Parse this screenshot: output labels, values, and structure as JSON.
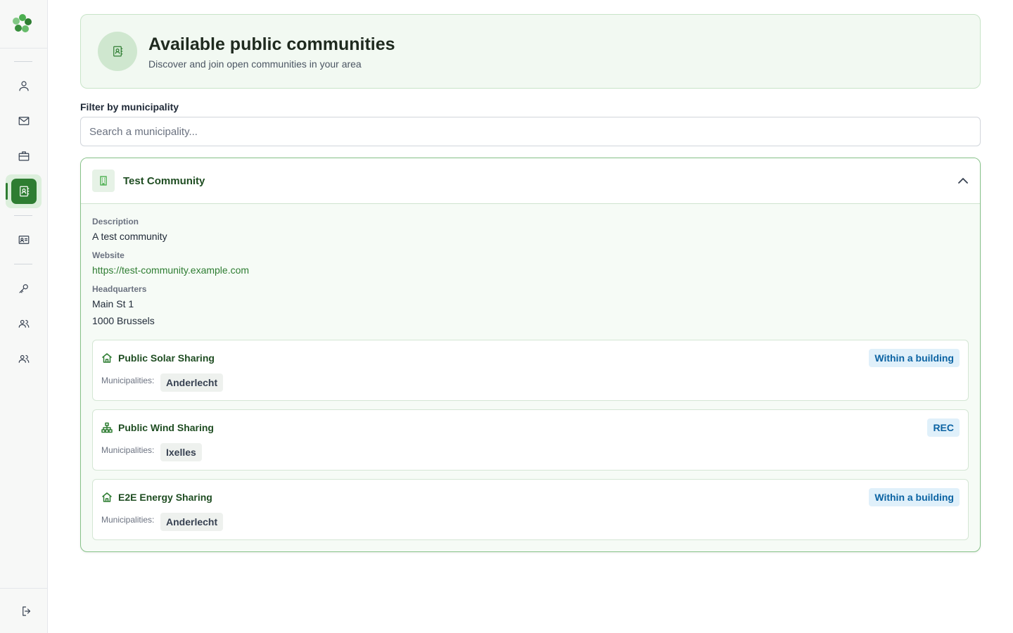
{
  "sidebar": {
    "items": [
      {
        "name": "person-icon"
      },
      {
        "name": "mail-icon"
      },
      {
        "name": "briefcase-icon"
      },
      {
        "name": "contact-book-icon",
        "active": true
      },
      {
        "name": "id-card-icon"
      },
      {
        "name": "key-icon"
      },
      {
        "name": "users-icon"
      },
      {
        "name": "users-icon"
      }
    ],
    "logout_icon": "logout-icon"
  },
  "header": {
    "title": "Available public communities",
    "subtitle": "Discover and join open communities in your area"
  },
  "filter": {
    "label": "Filter by municipality",
    "placeholder": "Search a municipality...",
    "value": ""
  },
  "community": {
    "name": "Test Community",
    "description_label": "Description",
    "description": "A test community",
    "website_label": "Website",
    "website": "https://test-community.example.com",
    "headquarters_label": "Headquarters",
    "address_line1": "Main St 1",
    "address_line2": "1000 Brussels",
    "sharings": [
      {
        "title": "Public Solar Sharing",
        "icon": "home-icon",
        "badge": "Within a building",
        "municipalities_label": "Municipalities:",
        "municipality": "Anderlecht"
      },
      {
        "title": "Public Wind Sharing",
        "icon": "network-icon",
        "badge": "REC",
        "municipalities_label": "Municipalities:",
        "municipality": "Ixelles"
      },
      {
        "title": "E2E Energy Sharing",
        "icon": "home-icon",
        "badge": "Within a building",
        "municipalities_label": "Municipalities:",
        "municipality": "Anderlecht"
      }
    ]
  },
  "colors": {
    "accent": "#2e7d32",
    "hero_bg": "#f2f9f2",
    "badge_bg": "#e0f0fa",
    "badge_text": "#0b63a3"
  }
}
